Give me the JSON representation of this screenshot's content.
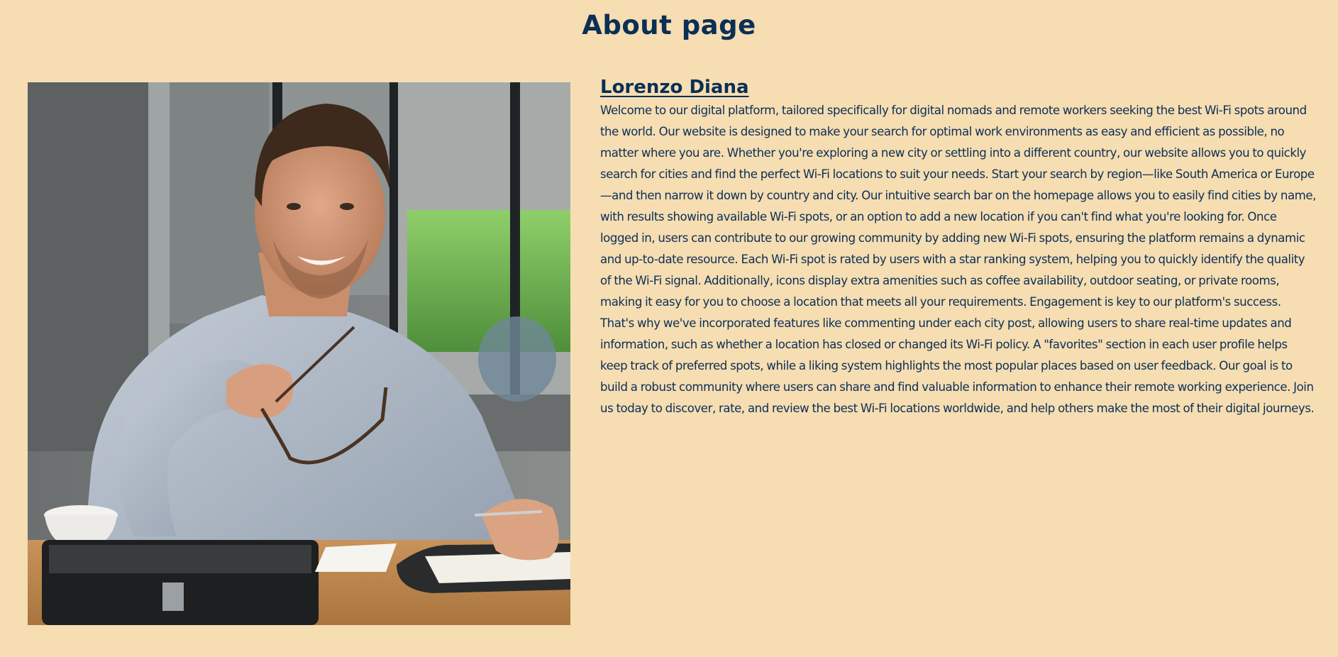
{
  "page": {
    "title": "About page"
  },
  "profile": {
    "name": "Lorenzo Diana",
    "photo_alt": "Smiling man holding glasses at a desk",
    "bio": "Welcome to our digital platform, tailored specifically for digital nomads and remote workers seeking the best Wi-Fi spots around the world. Our website is designed to make your search for optimal work environments as easy and efficient as possible, no matter where you are. Whether you're exploring a new city or settling into a different country, our website allows you to quickly search for cities and find the perfect Wi-Fi locations to suit your needs. Start your search by region—like South America or Europe—and then narrow it down by country and city. Our intuitive search bar on the homepage allows you to easily find cities by name, with results showing available Wi-Fi spots, or an option to add a new location if you can't find what you're looking for. Once logged in, users can contribute to our growing community by adding new Wi-Fi spots, ensuring the platform remains a dynamic and up-to-date resource. Each Wi-Fi spot is rated by users with a star ranking system, helping you to quickly identify the quality of the Wi-Fi signal. Additionally, icons display extra amenities such as coffee availability, outdoor seating, or private rooms, making it easy for you to choose a location that meets all your requirements. Engagement is key to our platform's success. That's why we've incorporated features like commenting under each city post, allowing users to share real-time updates and information, such as whether a location has closed or changed its Wi-Fi policy. A \"favorites\" section in each user profile helps keep track of preferred spots, while a liking system highlights the most popular places based on user feedback. Our goal is to build a robust community where users can share and find valuable information to enhance their remote working experience. Join us today to discover, rate, and review the best Wi-Fi locations worldwide, and help others make the most of their digital journeys."
  },
  "colors": {
    "background": "#f6ddb2",
    "text": "#0b2f55"
  }
}
